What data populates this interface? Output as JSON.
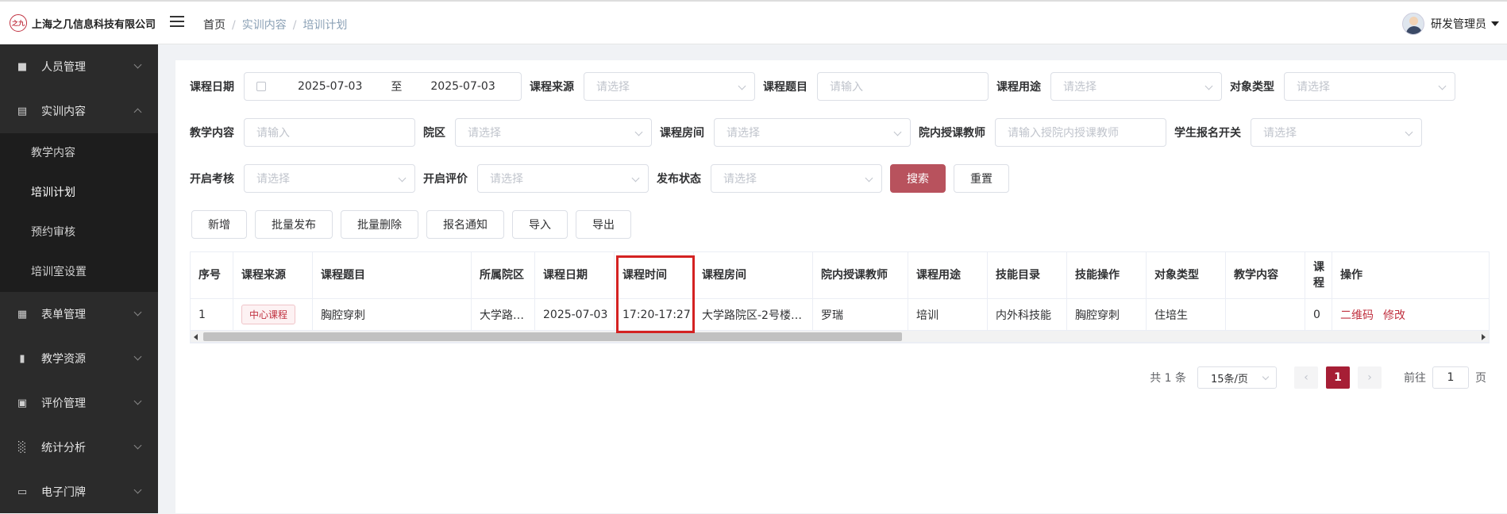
{
  "header": {
    "logo_mark": "之九",
    "company": "上海之几信息科技有限公司",
    "breadcrumb": [
      "首页",
      "实训内容",
      "培训计划"
    ],
    "user_name": "研发管理员"
  },
  "sidebar": {
    "menus": [
      {
        "label": "人员管理",
        "icon": "user-icon"
      },
      {
        "label": "实训内容",
        "icon": "training-icon",
        "expanded": true
      },
      {
        "label": "表单管理",
        "icon": "form-icon"
      },
      {
        "label": "教学资源",
        "icon": "resource-icon"
      },
      {
        "label": "评价管理",
        "icon": "evaluation-icon"
      },
      {
        "label": "统计分析",
        "icon": "chart-icon"
      },
      {
        "label": "电子门牌",
        "icon": "monitor-icon"
      }
    ],
    "submenu": [
      "教学内容",
      "培训计划",
      "预约审核",
      "培训室设置"
    ],
    "active_sub": "培训计划"
  },
  "filters": {
    "course_date": {
      "label": "课程日期",
      "start": "2025-07-03",
      "sep": "至",
      "end": "2025-07-03"
    },
    "course_source": {
      "label": "课程来源",
      "placeholder": "请选择"
    },
    "course_topic": {
      "label": "课程题目",
      "placeholder": "请输入"
    },
    "course_purpose": {
      "label": "课程用途",
      "placeholder": "请选择"
    },
    "object_type": {
      "label": "对象类型",
      "placeholder": "请选择"
    },
    "teaching_content": {
      "label": "教学内容",
      "placeholder": "请输入"
    },
    "campus": {
      "label": "院区",
      "placeholder": "请选择"
    },
    "course_room": {
      "label": "课程房间",
      "placeholder": "请选择"
    },
    "teacher": {
      "label": "院内授课教师",
      "placeholder": "请输入授院内授课教师"
    },
    "signup_switch": {
      "label": "学生报名开关",
      "placeholder": "请选择"
    },
    "exam_switch": {
      "label": "开启考核",
      "placeholder": "请选择"
    },
    "eval_switch": {
      "label": "开启评价",
      "placeholder": "请选择"
    },
    "publish_status": {
      "label": "发布状态",
      "placeholder": "请选择"
    },
    "search": "搜索",
    "reset": "重置"
  },
  "toolbar": [
    "新增",
    "批量发布",
    "批量删除",
    "报名通知",
    "导入",
    "导出"
  ],
  "table": {
    "headers": [
      "序号",
      "课程来源",
      "课程题目",
      "所属院区",
      "课程日期",
      "课程时间",
      "课程房间",
      "院内授课教师",
      "课程用途",
      "技能目录",
      "技能操作",
      "对象类型",
      "教学内容",
      "课程",
      "操作"
    ],
    "rows": [
      {
        "index": "1",
        "source": "中心课程",
        "topic": "胸腔穿刺",
        "campus": "大学路…",
        "date": "2025-07-03",
        "time": "17:20-17:27",
        "room": "大学路院区-2号楼…",
        "teacher": "罗瑞",
        "purpose": "培训",
        "skill_dir": "内外科技能",
        "skill_op": "胸腔穿刺",
        "object_type": "住培生",
        "content": "",
        "course_more": "0",
        "actions": [
          "二维码",
          "修改"
        ]
      }
    ]
  },
  "pagination": {
    "total": "共 1 条",
    "page_size": "15条/页",
    "current": "1",
    "goto_prefix": "前往",
    "goto_value": "1",
    "goto_suffix": "页"
  },
  "colors": {
    "accent": "#a61e35",
    "highlight": "#d42222"
  }
}
